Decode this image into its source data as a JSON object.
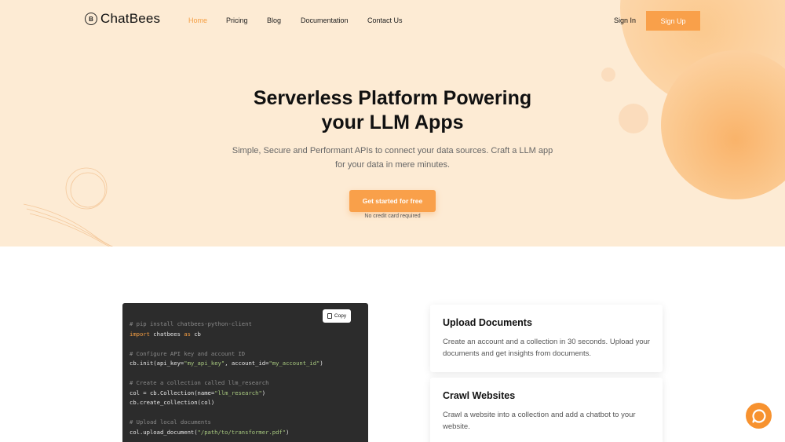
{
  "nav": {
    "logo_text": "ChatBees",
    "links": [
      "Home",
      "Pricing",
      "Blog",
      "Documentation",
      "Contact Us"
    ],
    "sign_in": "Sign In",
    "sign_up": "Sign Up"
  },
  "hero": {
    "title_line1": "Serverless Platform Powering",
    "title_line2": "your LLM Apps",
    "subtitle_line1": "Simple, Secure and Performant APIs to connect your data sources. Craft a LLM app",
    "subtitle_line2": "for your data in mere minutes.",
    "cta_label": "Get started for free",
    "cta_note": "No credit card required"
  },
  "code": {
    "copy_label": "Copy",
    "lines": [
      "# pip install chatbees-python-client",
      "import chatbees as cb",
      "",
      "# Configure API key and account ID",
      "cb.init(api_key=\"my_api_key\", account_id=\"my_account_id\")",
      "",
      "# Create a collection called llm_research",
      "col = cb.Collection(name=\"llm_research\")",
      "cb.create_collection(col)",
      "",
      "# Upload local documents",
      "col.upload_document(\"/path/to/transformer.pdf\")"
    ]
  },
  "features": [
    {
      "title": "Upload Documents",
      "description": "Create an account and a collection in 30 seconds. Upload your documents and get insights from documents."
    },
    {
      "title": "Crawl Websites",
      "description": "Crawl a website into a collection and add a chatbot to your website."
    }
  ],
  "colors": {
    "accent": "#f9a04a",
    "hero_bg": "#fdebd4",
    "code_bg": "#2c2c2c"
  },
  "icons": {
    "logo": "bee-logo-icon",
    "copy": "copy-icon",
    "chat": "chat-bubble-icon"
  }
}
